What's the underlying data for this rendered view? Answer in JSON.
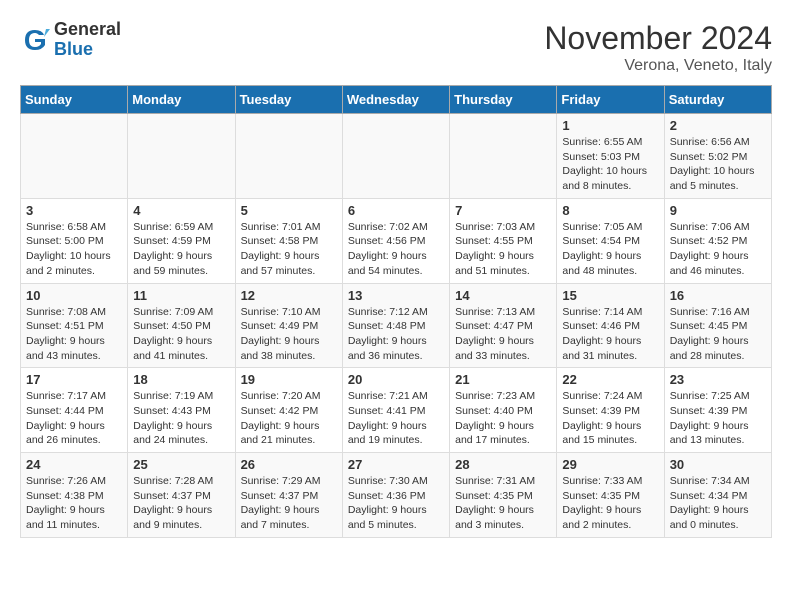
{
  "header": {
    "logo_general": "General",
    "logo_blue": "Blue",
    "month_title": "November 2024",
    "location": "Verona, Veneto, Italy"
  },
  "days_of_week": [
    "Sunday",
    "Monday",
    "Tuesday",
    "Wednesday",
    "Thursday",
    "Friday",
    "Saturday"
  ],
  "weeks": [
    [
      {
        "day": "",
        "info": ""
      },
      {
        "day": "",
        "info": ""
      },
      {
        "day": "",
        "info": ""
      },
      {
        "day": "",
        "info": ""
      },
      {
        "day": "",
        "info": ""
      },
      {
        "day": "1",
        "info": "Sunrise: 6:55 AM\nSunset: 5:03 PM\nDaylight: 10 hours and 8 minutes."
      },
      {
        "day": "2",
        "info": "Sunrise: 6:56 AM\nSunset: 5:02 PM\nDaylight: 10 hours and 5 minutes."
      }
    ],
    [
      {
        "day": "3",
        "info": "Sunrise: 6:58 AM\nSunset: 5:00 PM\nDaylight: 10 hours and 2 minutes."
      },
      {
        "day": "4",
        "info": "Sunrise: 6:59 AM\nSunset: 4:59 PM\nDaylight: 9 hours and 59 minutes."
      },
      {
        "day": "5",
        "info": "Sunrise: 7:01 AM\nSunset: 4:58 PM\nDaylight: 9 hours and 57 minutes."
      },
      {
        "day": "6",
        "info": "Sunrise: 7:02 AM\nSunset: 4:56 PM\nDaylight: 9 hours and 54 minutes."
      },
      {
        "day": "7",
        "info": "Sunrise: 7:03 AM\nSunset: 4:55 PM\nDaylight: 9 hours and 51 minutes."
      },
      {
        "day": "8",
        "info": "Sunrise: 7:05 AM\nSunset: 4:54 PM\nDaylight: 9 hours and 48 minutes."
      },
      {
        "day": "9",
        "info": "Sunrise: 7:06 AM\nSunset: 4:52 PM\nDaylight: 9 hours and 46 minutes."
      }
    ],
    [
      {
        "day": "10",
        "info": "Sunrise: 7:08 AM\nSunset: 4:51 PM\nDaylight: 9 hours and 43 minutes."
      },
      {
        "day": "11",
        "info": "Sunrise: 7:09 AM\nSunset: 4:50 PM\nDaylight: 9 hours and 41 minutes."
      },
      {
        "day": "12",
        "info": "Sunrise: 7:10 AM\nSunset: 4:49 PM\nDaylight: 9 hours and 38 minutes."
      },
      {
        "day": "13",
        "info": "Sunrise: 7:12 AM\nSunset: 4:48 PM\nDaylight: 9 hours and 36 minutes."
      },
      {
        "day": "14",
        "info": "Sunrise: 7:13 AM\nSunset: 4:47 PM\nDaylight: 9 hours and 33 minutes."
      },
      {
        "day": "15",
        "info": "Sunrise: 7:14 AM\nSunset: 4:46 PM\nDaylight: 9 hours and 31 minutes."
      },
      {
        "day": "16",
        "info": "Sunrise: 7:16 AM\nSunset: 4:45 PM\nDaylight: 9 hours and 28 minutes."
      }
    ],
    [
      {
        "day": "17",
        "info": "Sunrise: 7:17 AM\nSunset: 4:44 PM\nDaylight: 9 hours and 26 minutes."
      },
      {
        "day": "18",
        "info": "Sunrise: 7:19 AM\nSunset: 4:43 PM\nDaylight: 9 hours and 24 minutes."
      },
      {
        "day": "19",
        "info": "Sunrise: 7:20 AM\nSunset: 4:42 PM\nDaylight: 9 hours and 21 minutes."
      },
      {
        "day": "20",
        "info": "Sunrise: 7:21 AM\nSunset: 4:41 PM\nDaylight: 9 hours and 19 minutes."
      },
      {
        "day": "21",
        "info": "Sunrise: 7:23 AM\nSunset: 4:40 PM\nDaylight: 9 hours and 17 minutes."
      },
      {
        "day": "22",
        "info": "Sunrise: 7:24 AM\nSunset: 4:39 PM\nDaylight: 9 hours and 15 minutes."
      },
      {
        "day": "23",
        "info": "Sunrise: 7:25 AM\nSunset: 4:39 PM\nDaylight: 9 hours and 13 minutes."
      }
    ],
    [
      {
        "day": "24",
        "info": "Sunrise: 7:26 AM\nSunset: 4:38 PM\nDaylight: 9 hours and 11 minutes."
      },
      {
        "day": "25",
        "info": "Sunrise: 7:28 AM\nSunset: 4:37 PM\nDaylight: 9 hours and 9 minutes."
      },
      {
        "day": "26",
        "info": "Sunrise: 7:29 AM\nSunset: 4:37 PM\nDaylight: 9 hours and 7 minutes."
      },
      {
        "day": "27",
        "info": "Sunrise: 7:30 AM\nSunset: 4:36 PM\nDaylight: 9 hours and 5 minutes."
      },
      {
        "day": "28",
        "info": "Sunrise: 7:31 AM\nSunset: 4:35 PM\nDaylight: 9 hours and 3 minutes."
      },
      {
        "day": "29",
        "info": "Sunrise: 7:33 AM\nSunset: 4:35 PM\nDaylight: 9 hours and 2 minutes."
      },
      {
        "day": "30",
        "info": "Sunrise: 7:34 AM\nSunset: 4:34 PM\nDaylight: 9 hours and 0 minutes."
      }
    ]
  ]
}
